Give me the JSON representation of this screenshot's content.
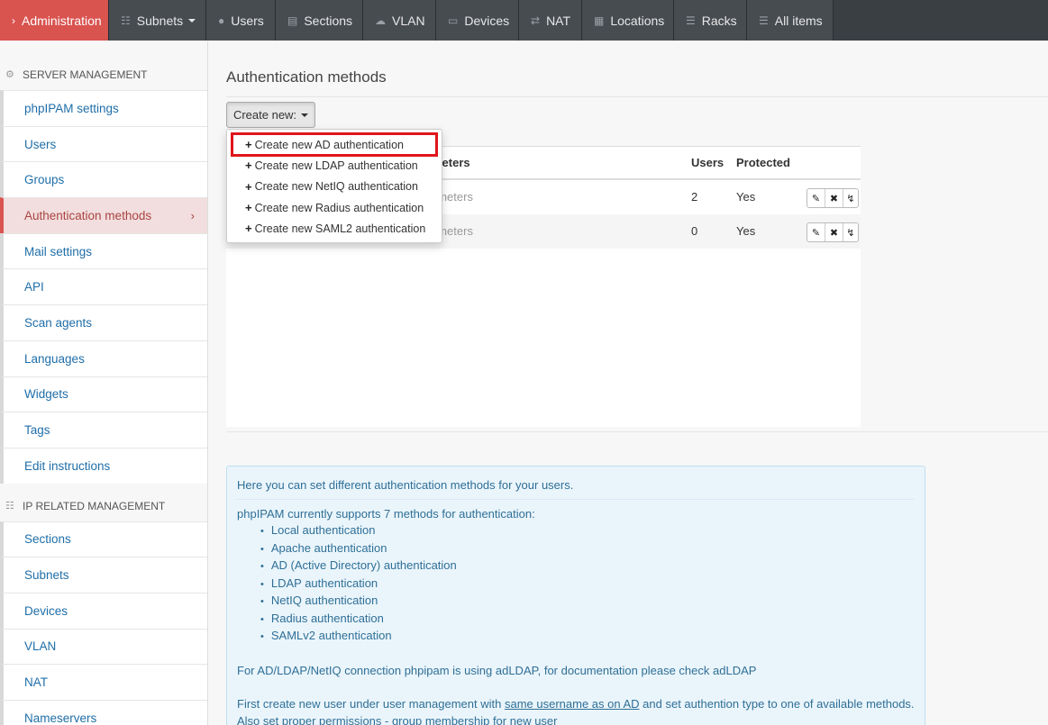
{
  "topnav": {
    "items": [
      {
        "label": "Administration",
        "icon": "chevron-right-icon"
      },
      {
        "label": "Subnets",
        "icon": "sitemap-icon"
      },
      {
        "label": "Users",
        "icon": "user-icon"
      },
      {
        "label": "Sections",
        "icon": "server-icon"
      },
      {
        "label": "VLAN",
        "icon": "cloud-icon"
      },
      {
        "label": "Devices",
        "icon": "desktop-icon"
      },
      {
        "label": "NAT",
        "icon": "exchange-icon"
      },
      {
        "label": "Locations",
        "icon": "map-icon"
      },
      {
        "label": "Racks",
        "icon": "bars-icon"
      },
      {
        "label": "All items",
        "icon": "list-icon"
      }
    ]
  },
  "sidebar": {
    "server_heading": "SERVER MANAGEMENT",
    "server_items": [
      "phpIPAM settings",
      "Users",
      "Groups",
      "Authentication methods",
      "Mail settings",
      "API",
      "Scan agents",
      "Languages",
      "Widgets",
      "Tags",
      "Edit instructions"
    ],
    "ip_heading": "IP RELATED MANAGEMENT",
    "ip_items": [
      "Sections",
      "Subnets",
      "Devices",
      "VLAN",
      "NAT",
      "Nameservers"
    ]
  },
  "main": {
    "title": "Authentication methods",
    "create_button": "Create new:",
    "dropdown": [
      "Create new AD authentication",
      "Create new LDAP authentication",
      "Create new NetIQ authentication",
      "Create new Radius authentication",
      "Create new SAML2 authentication"
    ],
    "table": {
      "headers": {
        "params": "meters",
        "users": "Users",
        "protected": "Protected"
      },
      "rows": [
        {
          "params": "ameters",
          "users": "2",
          "protected": "Yes"
        },
        {
          "params": "ameters",
          "users": "0",
          "protected": "Yes"
        }
      ]
    },
    "info": {
      "line1": "Here you can set different authentication methods for your users.",
      "line2": "phpIPAM currently supports 7 methods for authentication:",
      "methods": [
        "Local authentication",
        "Apache authentication",
        "AD (Active Directory) authentication",
        "LDAP authentication",
        "NetIQ authentication",
        "Radius authentication",
        "SAMLv2 authentication"
      ],
      "adldap_note": "For AD/LDAP/NetIQ connection phpipam is using adLDAP, for documentation please check adLDAP",
      "user_note_pre": "First create new user under user management with ",
      "user_note_link": "same username as on AD",
      "user_note_post": " and set authention type to one of available methods.",
      "perm_note": "Also set proper permissions - group membership for new user"
    }
  },
  "colors": {
    "accent": "#d9534f",
    "navbar": "#3a3f44",
    "link": "#1f6ea8",
    "highlight_border": "#e0151b"
  }
}
